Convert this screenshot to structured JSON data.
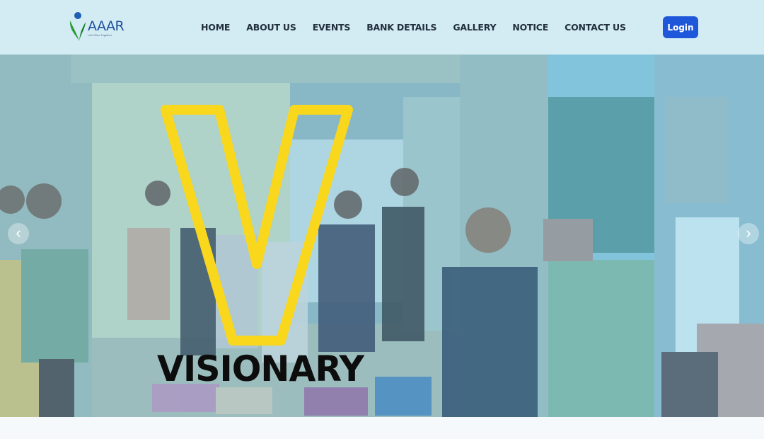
{
  "brand": {
    "name": "AAAR",
    "tagline": "Let's Rise Together"
  },
  "nav": {
    "items": [
      {
        "label": "HOME"
      },
      {
        "label": "ABOUT US"
      },
      {
        "label": "EVENTS"
      },
      {
        "label": "BANK DETAILS"
      },
      {
        "label": "GALLERY"
      },
      {
        "label": "NOTICE"
      },
      {
        "label": "CONTACT US"
      }
    ],
    "login_label": "Login"
  },
  "hero": {
    "letter": "V",
    "word": "VISIONARY",
    "prev_icon": "chevron-left-icon",
    "next_icon": "chevron-right-icon"
  },
  "colors": {
    "navbar_bg": "#d3ecf4",
    "accent_blue": "#1f57db",
    "logo_green": "#2e9b3a",
    "v_yellow": "#f9d71c"
  }
}
